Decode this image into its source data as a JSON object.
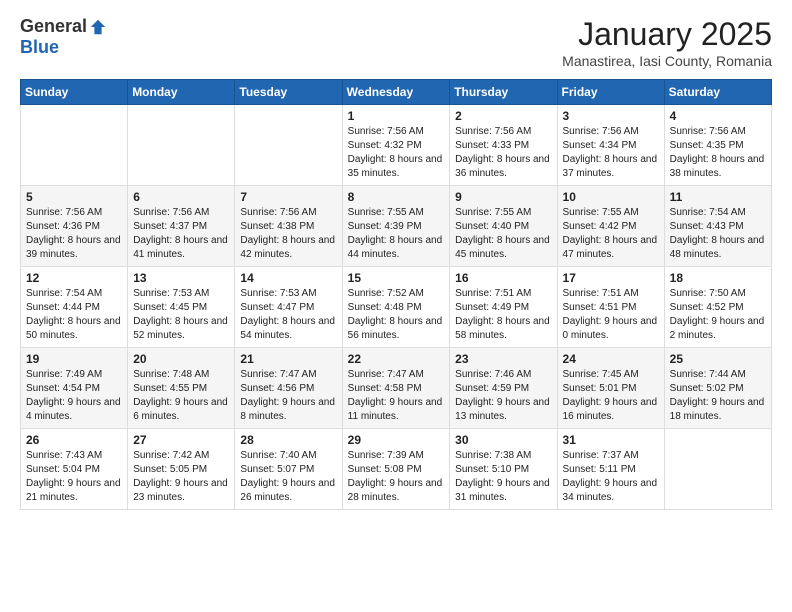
{
  "logo": {
    "general": "General",
    "blue": "Blue"
  },
  "header": {
    "title": "January 2025",
    "subtitle": "Manastirea, Iasi County, Romania"
  },
  "weekdays": [
    "Sunday",
    "Monday",
    "Tuesday",
    "Wednesday",
    "Thursday",
    "Friday",
    "Saturday"
  ],
  "weeks": [
    [
      {
        "day": "",
        "info": ""
      },
      {
        "day": "",
        "info": ""
      },
      {
        "day": "",
        "info": ""
      },
      {
        "day": "1",
        "info": "Sunrise: 7:56 AM\nSunset: 4:32 PM\nDaylight: 8 hours and 35 minutes."
      },
      {
        "day": "2",
        "info": "Sunrise: 7:56 AM\nSunset: 4:33 PM\nDaylight: 8 hours and 36 minutes."
      },
      {
        "day": "3",
        "info": "Sunrise: 7:56 AM\nSunset: 4:34 PM\nDaylight: 8 hours and 37 minutes."
      },
      {
        "day": "4",
        "info": "Sunrise: 7:56 AM\nSunset: 4:35 PM\nDaylight: 8 hours and 38 minutes."
      }
    ],
    [
      {
        "day": "5",
        "info": "Sunrise: 7:56 AM\nSunset: 4:36 PM\nDaylight: 8 hours and 39 minutes."
      },
      {
        "day": "6",
        "info": "Sunrise: 7:56 AM\nSunset: 4:37 PM\nDaylight: 8 hours and 41 minutes."
      },
      {
        "day": "7",
        "info": "Sunrise: 7:56 AM\nSunset: 4:38 PM\nDaylight: 8 hours and 42 minutes."
      },
      {
        "day": "8",
        "info": "Sunrise: 7:55 AM\nSunset: 4:39 PM\nDaylight: 8 hours and 44 minutes."
      },
      {
        "day": "9",
        "info": "Sunrise: 7:55 AM\nSunset: 4:40 PM\nDaylight: 8 hours and 45 minutes."
      },
      {
        "day": "10",
        "info": "Sunrise: 7:55 AM\nSunset: 4:42 PM\nDaylight: 8 hours and 47 minutes."
      },
      {
        "day": "11",
        "info": "Sunrise: 7:54 AM\nSunset: 4:43 PM\nDaylight: 8 hours and 48 minutes."
      }
    ],
    [
      {
        "day": "12",
        "info": "Sunrise: 7:54 AM\nSunset: 4:44 PM\nDaylight: 8 hours and 50 minutes."
      },
      {
        "day": "13",
        "info": "Sunrise: 7:53 AM\nSunset: 4:45 PM\nDaylight: 8 hours and 52 minutes."
      },
      {
        "day": "14",
        "info": "Sunrise: 7:53 AM\nSunset: 4:47 PM\nDaylight: 8 hours and 54 minutes."
      },
      {
        "day": "15",
        "info": "Sunrise: 7:52 AM\nSunset: 4:48 PM\nDaylight: 8 hours and 56 minutes."
      },
      {
        "day": "16",
        "info": "Sunrise: 7:51 AM\nSunset: 4:49 PM\nDaylight: 8 hours and 58 minutes."
      },
      {
        "day": "17",
        "info": "Sunrise: 7:51 AM\nSunset: 4:51 PM\nDaylight: 9 hours and 0 minutes."
      },
      {
        "day": "18",
        "info": "Sunrise: 7:50 AM\nSunset: 4:52 PM\nDaylight: 9 hours and 2 minutes."
      }
    ],
    [
      {
        "day": "19",
        "info": "Sunrise: 7:49 AM\nSunset: 4:54 PM\nDaylight: 9 hours and 4 minutes."
      },
      {
        "day": "20",
        "info": "Sunrise: 7:48 AM\nSunset: 4:55 PM\nDaylight: 9 hours and 6 minutes."
      },
      {
        "day": "21",
        "info": "Sunrise: 7:47 AM\nSunset: 4:56 PM\nDaylight: 9 hours and 8 minutes."
      },
      {
        "day": "22",
        "info": "Sunrise: 7:47 AM\nSunset: 4:58 PM\nDaylight: 9 hours and 11 minutes."
      },
      {
        "day": "23",
        "info": "Sunrise: 7:46 AM\nSunset: 4:59 PM\nDaylight: 9 hours and 13 minutes."
      },
      {
        "day": "24",
        "info": "Sunrise: 7:45 AM\nSunset: 5:01 PM\nDaylight: 9 hours and 16 minutes."
      },
      {
        "day": "25",
        "info": "Sunrise: 7:44 AM\nSunset: 5:02 PM\nDaylight: 9 hours and 18 minutes."
      }
    ],
    [
      {
        "day": "26",
        "info": "Sunrise: 7:43 AM\nSunset: 5:04 PM\nDaylight: 9 hours and 21 minutes."
      },
      {
        "day": "27",
        "info": "Sunrise: 7:42 AM\nSunset: 5:05 PM\nDaylight: 9 hours and 23 minutes."
      },
      {
        "day": "28",
        "info": "Sunrise: 7:40 AM\nSunset: 5:07 PM\nDaylight: 9 hours and 26 minutes."
      },
      {
        "day": "29",
        "info": "Sunrise: 7:39 AM\nSunset: 5:08 PM\nDaylight: 9 hours and 28 minutes."
      },
      {
        "day": "30",
        "info": "Sunrise: 7:38 AM\nSunset: 5:10 PM\nDaylight: 9 hours and 31 minutes."
      },
      {
        "day": "31",
        "info": "Sunrise: 7:37 AM\nSunset: 5:11 PM\nDaylight: 9 hours and 34 minutes."
      },
      {
        "day": "",
        "info": ""
      }
    ]
  ]
}
